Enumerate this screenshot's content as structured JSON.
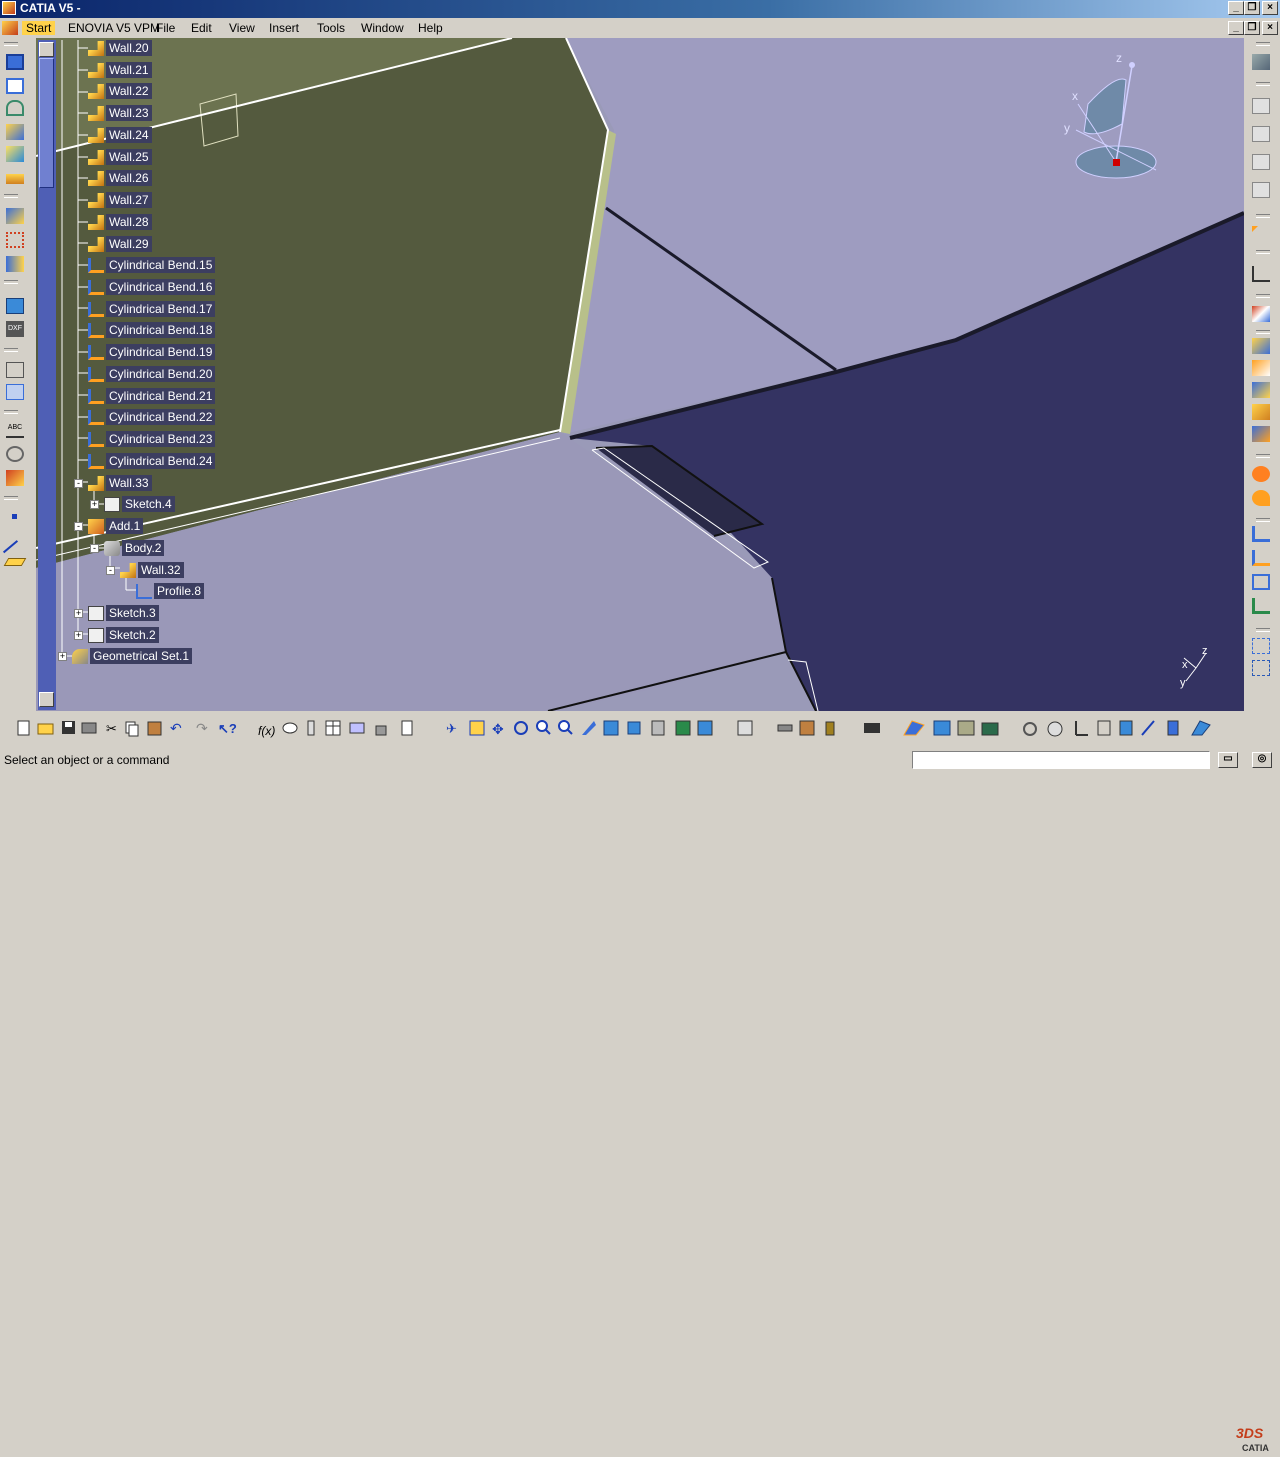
{
  "window": {
    "title": "CATIA V5 - ",
    "controls": [
      "minimize",
      "restore",
      "close"
    ]
  },
  "menubar": {
    "items": [
      {
        "label": "Start",
        "active": true
      },
      {
        "label": "ENOVIA V5 VPM"
      },
      {
        "label": "File"
      },
      {
        "label": "Edit"
      },
      {
        "label": "View"
      },
      {
        "label": "Insert"
      },
      {
        "label": "Tools"
      },
      {
        "label": "Window"
      },
      {
        "label": "Help"
      }
    ]
  },
  "tree": {
    "items": [
      {
        "label": "Wall.20",
        "icon": "wall-icon"
      },
      {
        "label": "Wall.21",
        "icon": "wall-icon"
      },
      {
        "label": "Wall.22",
        "icon": "wall-icon"
      },
      {
        "label": "Wall.23",
        "icon": "wall-icon"
      },
      {
        "label": "Wall.24",
        "icon": "wall-icon"
      },
      {
        "label": "Wall.25",
        "icon": "wall-icon"
      },
      {
        "label": "Wall.26",
        "icon": "wall-icon"
      },
      {
        "label": "Wall.27",
        "icon": "wall-icon"
      },
      {
        "label": "Wall.28",
        "icon": "wall-icon"
      },
      {
        "label": "Wall.29",
        "icon": "wall-icon"
      },
      {
        "label": "Cylindrical Bend.15",
        "icon": "cylindrical-bend-icon"
      },
      {
        "label": "Cylindrical Bend.16",
        "icon": "cylindrical-bend-icon"
      },
      {
        "label": "Cylindrical Bend.17",
        "icon": "cylindrical-bend-icon"
      },
      {
        "label": "Cylindrical Bend.18",
        "icon": "cylindrical-bend-icon"
      },
      {
        "label": "Cylindrical Bend.19",
        "icon": "cylindrical-bend-icon"
      },
      {
        "label": "Cylindrical Bend.20",
        "icon": "cylindrical-bend-icon"
      },
      {
        "label": "Cylindrical Bend.21",
        "icon": "cylindrical-bend-icon"
      },
      {
        "label": "Cylindrical Bend.22",
        "icon": "cylindrical-bend-icon"
      },
      {
        "label": "Cylindrical Bend.23",
        "icon": "cylindrical-bend-icon"
      },
      {
        "label": "Cylindrical Bend.24",
        "icon": "cylindrical-bend-icon"
      },
      {
        "label": "Wall.33",
        "icon": "wall-icon",
        "expander": "-"
      },
      {
        "label": "Sketch.4",
        "icon": "sketch-icon",
        "expander": "+"
      },
      {
        "label": "Add.1",
        "icon": "add-icon",
        "expander": "-"
      },
      {
        "label": "Body.2",
        "icon": "body-icon",
        "expander": "-"
      },
      {
        "label": "Wall.32",
        "icon": "wall-icon",
        "expander": "-"
      },
      {
        "label": "Profile.8",
        "icon": "profile-icon"
      },
      {
        "label": "Sketch.3",
        "icon": "sketch-icon",
        "expander": "+"
      },
      {
        "label": "Sketch.2",
        "icon": "sketch-icon",
        "expander": "+"
      },
      {
        "label": "Geometrical Set.1",
        "icon": "geometrical-set-icon",
        "expander": "+"
      }
    ]
  },
  "compass": {
    "x": "x",
    "y": "y",
    "z": "z"
  },
  "axis_triad": {
    "x": "x",
    "y": "y",
    "z": "z"
  },
  "status": {
    "message": "Select an object or a command",
    "command_value": ""
  },
  "logo": {
    "text": "CATIA"
  },
  "colors": {
    "viewport_bg": "#9a9ab8",
    "dark_panel": "#343362",
    "olive_panel": "#5a6040",
    "tree_label_bg": "#3c3e60",
    "title_gradient_start": "#0a246a"
  }
}
